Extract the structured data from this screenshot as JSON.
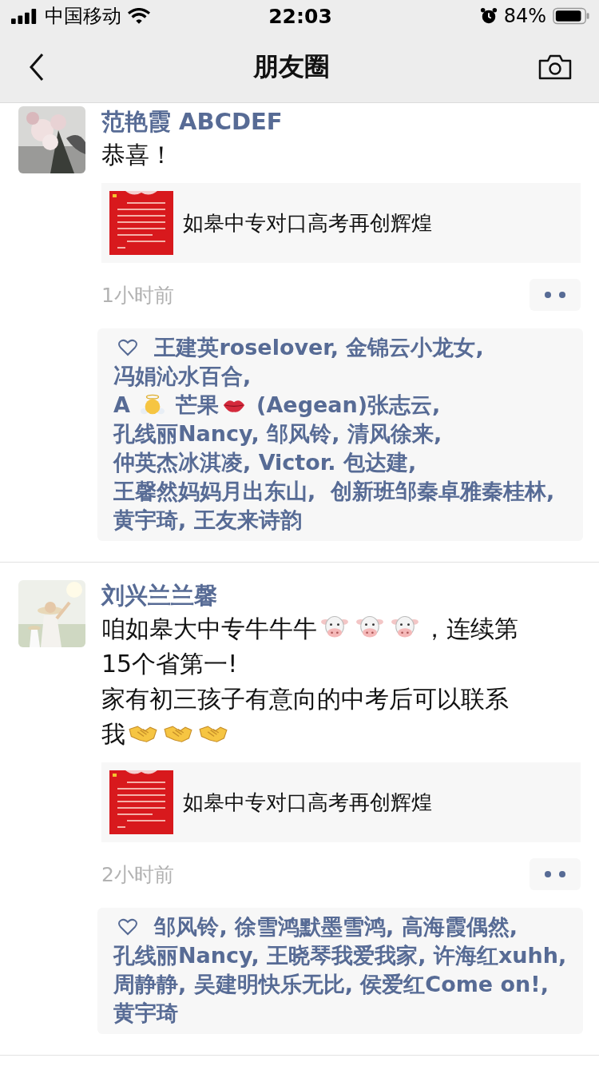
{
  "status_bar": {
    "carrier": "中国移动",
    "time": "22:03",
    "battery": "84%"
  },
  "nav": {
    "title": "朋友圈"
  },
  "posts": [
    {
      "author": "范艳霞 ABCDEF",
      "body": [
        [
          {
            "kind": "text",
            "text": "恭喜！"
          }
        ]
      ],
      "link": {
        "title": "如皋中专对口高考再创辉煌"
      },
      "time": "1小时前",
      "likes": {
        "separator": ", ",
        "likers": [
          {
            "parts": [
              {
                "kind": "text",
                "text": "王建英roselover"
              }
            ]
          },
          {
            "parts": [
              {
                "kind": "text",
                "text": "金锦云小龙女"
              }
            ]
          },
          {
            "parts": [
              {
                "kind": "text",
                "text": "冯娟沁水百合"
              }
            ]
          },
          {
            "parts": [
              {
                "kind": "text",
                "text": "A "
              },
              {
                "kind": "angel"
              },
              {
                "kind": "text",
                "text": " 芒果"
              },
              {
                "kind": "kiss"
              },
              {
                "kind": "text",
                "text": " (Aegean)张志云"
              }
            ]
          },
          {
            "parts": [
              {
                "kind": "text",
                "text": "孔线丽Nancy"
              }
            ]
          },
          {
            "parts": [
              {
                "kind": "text",
                "text": "邹风铃"
              }
            ]
          },
          {
            "parts": [
              {
                "kind": "text",
                "text": "清风徐来"
              }
            ]
          },
          {
            "parts": [
              {
                "kind": "text",
                "text": "仲英杰冰淇凌"
              }
            ]
          },
          {
            "parts": [
              {
                "kind": "text",
                "text": "Victor. 包达建"
              }
            ]
          },
          {
            "parts": [
              {
                "kind": "text",
                "text": "王馨然妈妈月出东山"
              }
            ]
          },
          {
            "parts": [
              {
                "kind": "text",
                "text": " 创新班邹秦卓雅秦桂林"
              }
            ]
          },
          {
            "parts": [
              {
                "kind": "text",
                "text": "黄宇琦"
              }
            ]
          },
          {
            "parts": [
              {
                "kind": "text",
                "text": "王友来诗韵"
              }
            ]
          }
        ]
      }
    },
    {
      "author": "刘兴兰兰馨",
      "body": [
        [
          {
            "kind": "text",
            "text": "咱如皋大中专牛牛牛"
          },
          {
            "kind": "cow"
          },
          {
            "kind": "cow"
          },
          {
            "kind": "cow"
          },
          {
            "kind": "text",
            "text": "，连续第"
          }
        ],
        [
          {
            "kind": "text",
            "text": "15个省第一!"
          }
        ],
        [
          {
            "kind": "text",
            "text": "家有初三孩子有意向的中考后可以联系"
          }
        ],
        [
          {
            "kind": "text",
            "text": "我"
          },
          {
            "kind": "handshake"
          },
          {
            "kind": "handshake"
          },
          {
            "kind": "handshake"
          }
        ]
      ],
      "link": {
        "title": "如皋中专对口高考再创辉煌"
      },
      "time": "2小时前",
      "likes": {
        "separator": ", ",
        "likers": [
          {
            "parts": [
              {
                "kind": "text",
                "text": "邹风铃"
              }
            ]
          },
          {
            "parts": [
              {
                "kind": "text",
                "text": "徐雪鸿默墨雪鸿"
              }
            ]
          },
          {
            "parts": [
              {
                "kind": "text",
                "text": "高海霞偶然"
              }
            ]
          },
          {
            "parts": [
              {
                "kind": "text",
                "text": "孔线丽Nancy"
              }
            ]
          },
          {
            "parts": [
              {
                "kind": "text",
                "text": "王晓琴我爱我家"
              }
            ]
          },
          {
            "parts": [
              {
                "kind": "text",
                "text": "许海红xuhh"
              }
            ]
          },
          {
            "parts": [
              {
                "kind": "text",
                "text": "周静静"
              }
            ]
          },
          {
            "parts": [
              {
                "kind": "text",
                "text": "吴建明快乐无比"
              }
            ]
          },
          {
            "parts": [
              {
                "kind": "text",
                "text": "侯爱红Come on!"
              }
            ]
          },
          {
            "parts": [
              {
                "kind": "text",
                "text": "黄宇琦"
              }
            ]
          }
        ]
      }
    }
  ]
}
